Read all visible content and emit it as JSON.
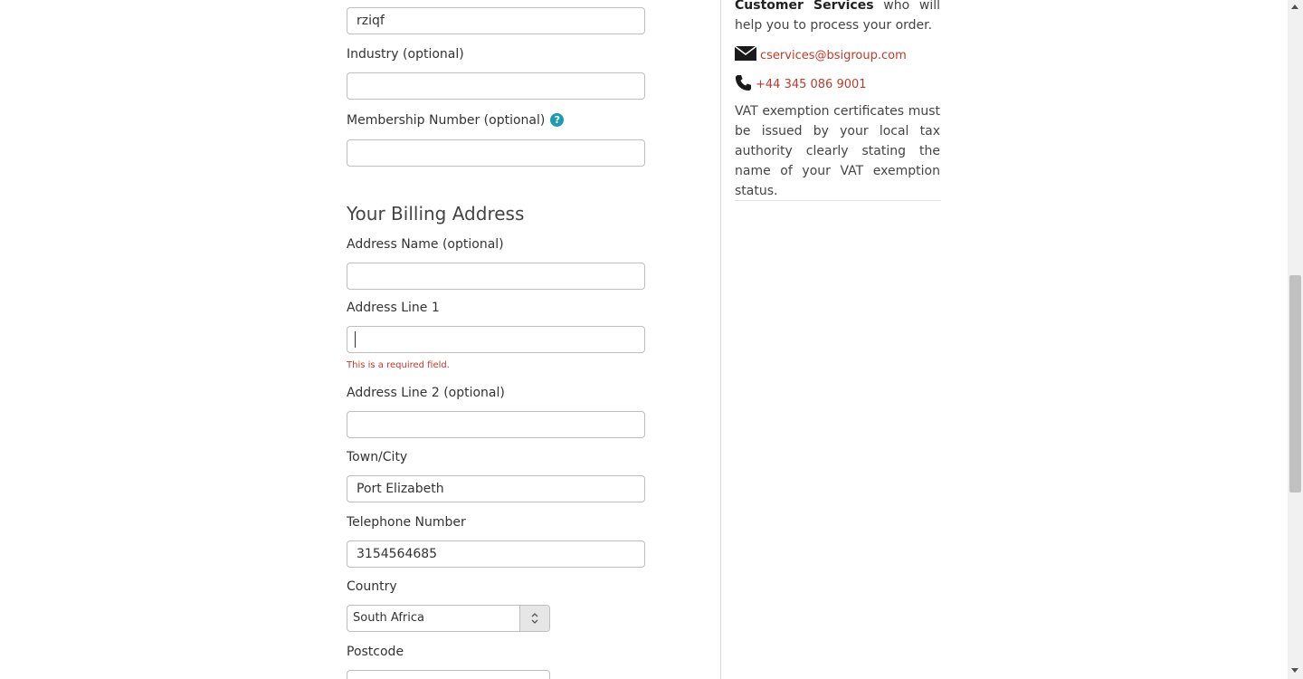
{
  "form": {
    "top_field_value": "rziqf",
    "industry_label": "Industry (optional)",
    "industry_value": "",
    "membership_label": "Membership Number (optional)",
    "membership_help_glyph": "?",
    "membership_value": "",
    "billing_title": "Your Billing Address",
    "address_name_label": "Address Name (optional)",
    "address_name_value": "",
    "address_line1_label": "Address Line 1",
    "address_line1_value": "",
    "address_line1_error": "This is a required field.",
    "address_line2_label": "Address Line 2 (optional)",
    "address_line2_value": "",
    "town_label": "Town/City",
    "town_value": "Port Elizabeth",
    "telephone_label": "Telephone Number",
    "telephone_value": "3154564685",
    "country_label": "Country",
    "country_value": "South Africa",
    "postcode_label": "Postcode",
    "postcode_value": ""
  },
  "sidebar": {
    "intro_bold": "Customer Services",
    "intro_rest": " who will help you to process your order.",
    "email": "cservices@bsigroup.com",
    "phone": "+44 345 086 9001",
    "vat_note": "VAT exemption certificates must be issued by your local tax authority clearly stating the name of your VAT exemption status."
  },
  "colors": {
    "link": "#c0392b",
    "error": "#c0392b",
    "help_icon": "#1a9cb0"
  },
  "icons": [
    "envelope-icon",
    "phone-icon",
    "help-icon",
    "select-arrows-icon"
  ]
}
